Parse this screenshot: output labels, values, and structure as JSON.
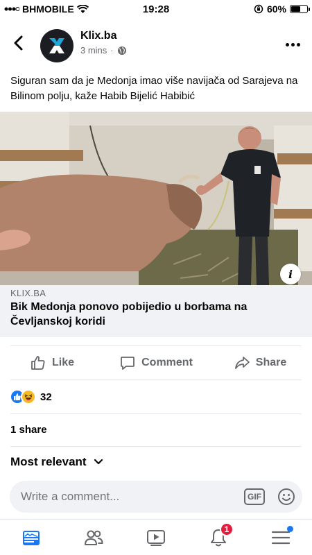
{
  "status_bar": {
    "carrier": "BHMOBILE",
    "time": "19:28",
    "battery_percent": "60%",
    "battery_level": 0.6
  },
  "post": {
    "page_name": "Klix.ba",
    "time_ago": "3 mins",
    "separator": "·",
    "privacy_icon": "globe-icon",
    "text": "Siguran sam da je Medonja imao više navijača od Sarajeva na Bilinom polju, kaže Habib Bijelić Habibić",
    "link": {
      "domain": "KLIX.BA",
      "title": "Bik Medonja ponovo pobijedio u borbama na Čevljanskoj koridi"
    }
  },
  "actions": {
    "like": "Like",
    "comment": "Comment",
    "share": "Share"
  },
  "stats": {
    "reaction_count": "32",
    "shares": "1 share"
  },
  "comments": {
    "sort_label": "Most relevant",
    "placeholder": "Write a comment...",
    "gif_label": "GIF"
  },
  "tabs": [
    {
      "name": "news-feed",
      "icon": "news-feed-icon"
    },
    {
      "name": "friends",
      "icon": "friends-icon"
    },
    {
      "name": "watch",
      "icon": "watch-icon"
    },
    {
      "name": "notifications",
      "icon": "bell-icon",
      "badge": "1"
    },
    {
      "name": "menu",
      "icon": "menu-icon"
    }
  ],
  "colors": {
    "accent": "#1877f2",
    "badge": "#e41e3f",
    "secondary_text": "#65676b",
    "surface": "#f0f2f5"
  }
}
